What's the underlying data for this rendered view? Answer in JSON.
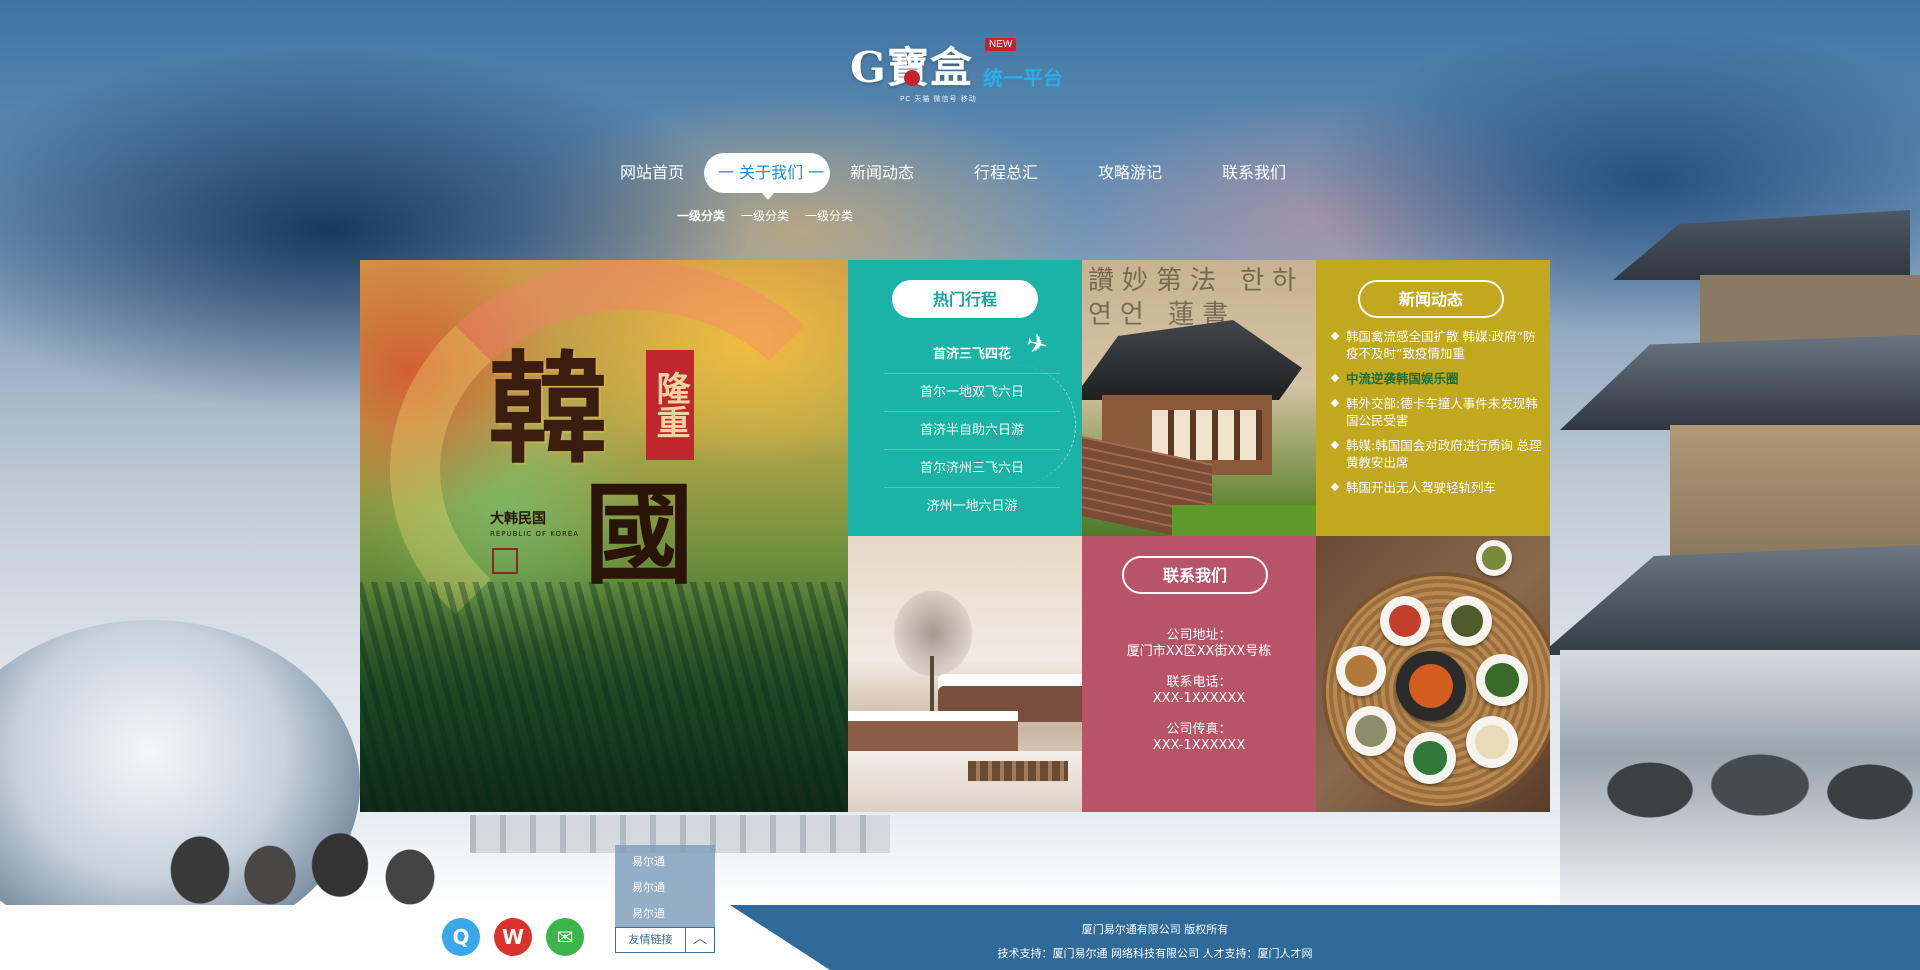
{
  "header": {
    "logo_main": "G寶盒",
    "logo_badge": "NEW",
    "logo_subtitle": "统一平台",
    "logo_tagline": "PC 天猫 微信号 移动"
  },
  "nav": {
    "items": [
      {
        "label": "网站首页"
      },
      {
        "label": "一 关于我们 一"
      },
      {
        "label": "新闻动态"
      },
      {
        "label": "行程总汇"
      },
      {
        "label": "攻略游记"
      },
      {
        "label": "联系我们"
      }
    ],
    "active_index": 1
  },
  "subnav": {
    "items": [
      "一级分类",
      "一级分类",
      "一级分类"
    ]
  },
  "banner": {
    "title_char_1": "韓",
    "title_char_2": "國",
    "badge": "隆重",
    "ribbon": "大韩民国",
    "republic": "REPUBLIC OF KOREA"
  },
  "hot_trips": {
    "heading": "热门行程",
    "items": [
      "首济三飞四花",
      "首尔一地双飞六日",
      "首济半自助六日游",
      "首尔济州三飞六日",
      "济州一地六日游"
    ]
  },
  "news": {
    "heading": "新闻动态",
    "items": [
      "韩国禽流感全国扩散 韩媒:政府“防疫不及时”致疫情加重",
      "中流逆袭韩国娱乐圈",
      "韩外交部:德卡车撞人事件未发现韩国公民受害",
      "韩媒:韩国国会对政府进行质询 总理黄教安出席",
      "韩国开出无人驾驶轻轨列车"
    ],
    "highlight_index": 1
  },
  "contact": {
    "heading": "联系我们",
    "address_label": "公司地址：",
    "address": "厦门市XX区XX街XX号栋",
    "phone_label": "联系电话：",
    "phone": "XXX-1XXXXXX",
    "fax_label": "公司传真：",
    "fax": "XXX-1XXXXXX"
  },
  "friend_links": {
    "button_label": "友情链接",
    "items": [
      "易尔通",
      "易尔通",
      "易尔通"
    ]
  },
  "footer": {
    "copyright": "厦门易尔通有限公司  版权所有",
    "support": "技术支持：厦门易尔通 网络科技有限公司 人才支持：厦门人才网"
  },
  "colors": {
    "hot_bg": "#1ab3a5",
    "news_bg": "#c2a81f",
    "contact_bg": "#b85468",
    "footer_bg": "#2f6a99",
    "nav_active_text": "#1c8fd6"
  }
}
